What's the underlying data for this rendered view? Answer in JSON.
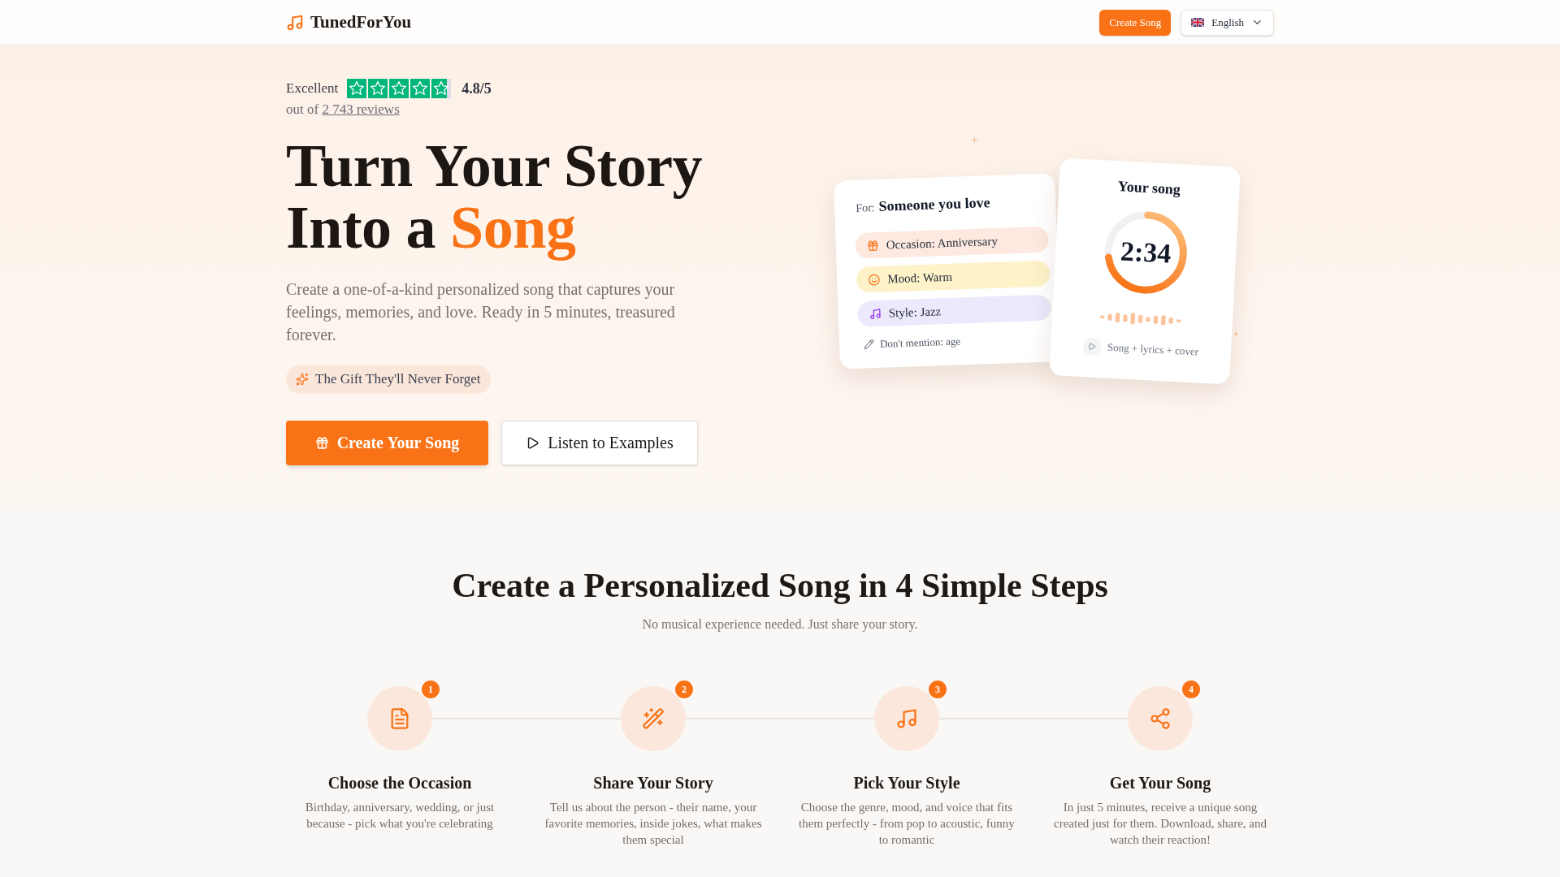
{
  "header": {
    "brand": "TunedForYou",
    "cta": "Create Song",
    "language": "English"
  },
  "hero": {
    "rating": {
      "label": "Excellent",
      "stars": 4.8,
      "score": "4.8/5",
      "reviews_prefix": "out of",
      "reviews_link": "2 743 reviews"
    },
    "title_lines": [
      "Turn Your Story",
      "Into a"
    ],
    "title_accent": "Song",
    "description": "Create a one-of-a-kind personalized song that captures your feelings, memories, and love. Ready in 5 minutes, treasured forever.",
    "badge": "The Gift They'll Never Forget",
    "primary_button": "Create Your Song",
    "secondary_button": "Listen to Examples"
  },
  "preview": {
    "brief_card": {
      "for_label": "For:",
      "recipient": "Someone you love",
      "chips": [
        {
          "label": "Occasion: Anniversary",
          "color": "#fde9df"
        },
        {
          "label": "Mood: Warm",
          "color": "#fdf2c8"
        },
        {
          "label": "Style: Jazz",
          "color": "#ece9fd"
        }
      ],
      "note": "Don't mention: age"
    },
    "song_card": {
      "title": "Your song",
      "duration": "2:34",
      "level": 0.72,
      "caption": "Song + lyrics + cover"
    }
  },
  "steps_section": {
    "title": "Create a Personalized Song in 4 Simple Steps",
    "subtitle": "No musical experience needed. Just share your story.",
    "steps": [
      {
        "number": "1",
        "title": "Choose the Occasion",
        "description": "Birthday, anniversary, wedding, or just because - pick what you're celebrating"
      },
      {
        "number": "2",
        "title": "Share Your Story",
        "description": "Tell us about the person - their name, your favorite memories, inside jokes, what makes them special"
      },
      {
        "number": "3",
        "title": "Pick Your Style",
        "description": "Choose the genre, mood, and voice that fits them perfectly - from pop to acoustic, funny to romantic"
      },
      {
        "number": "4",
        "title": "Get Your Song",
        "description": "In just 5 minutes, receive a unique song created just for them. Download, share, and watch their reaction!"
      }
    ]
  }
}
